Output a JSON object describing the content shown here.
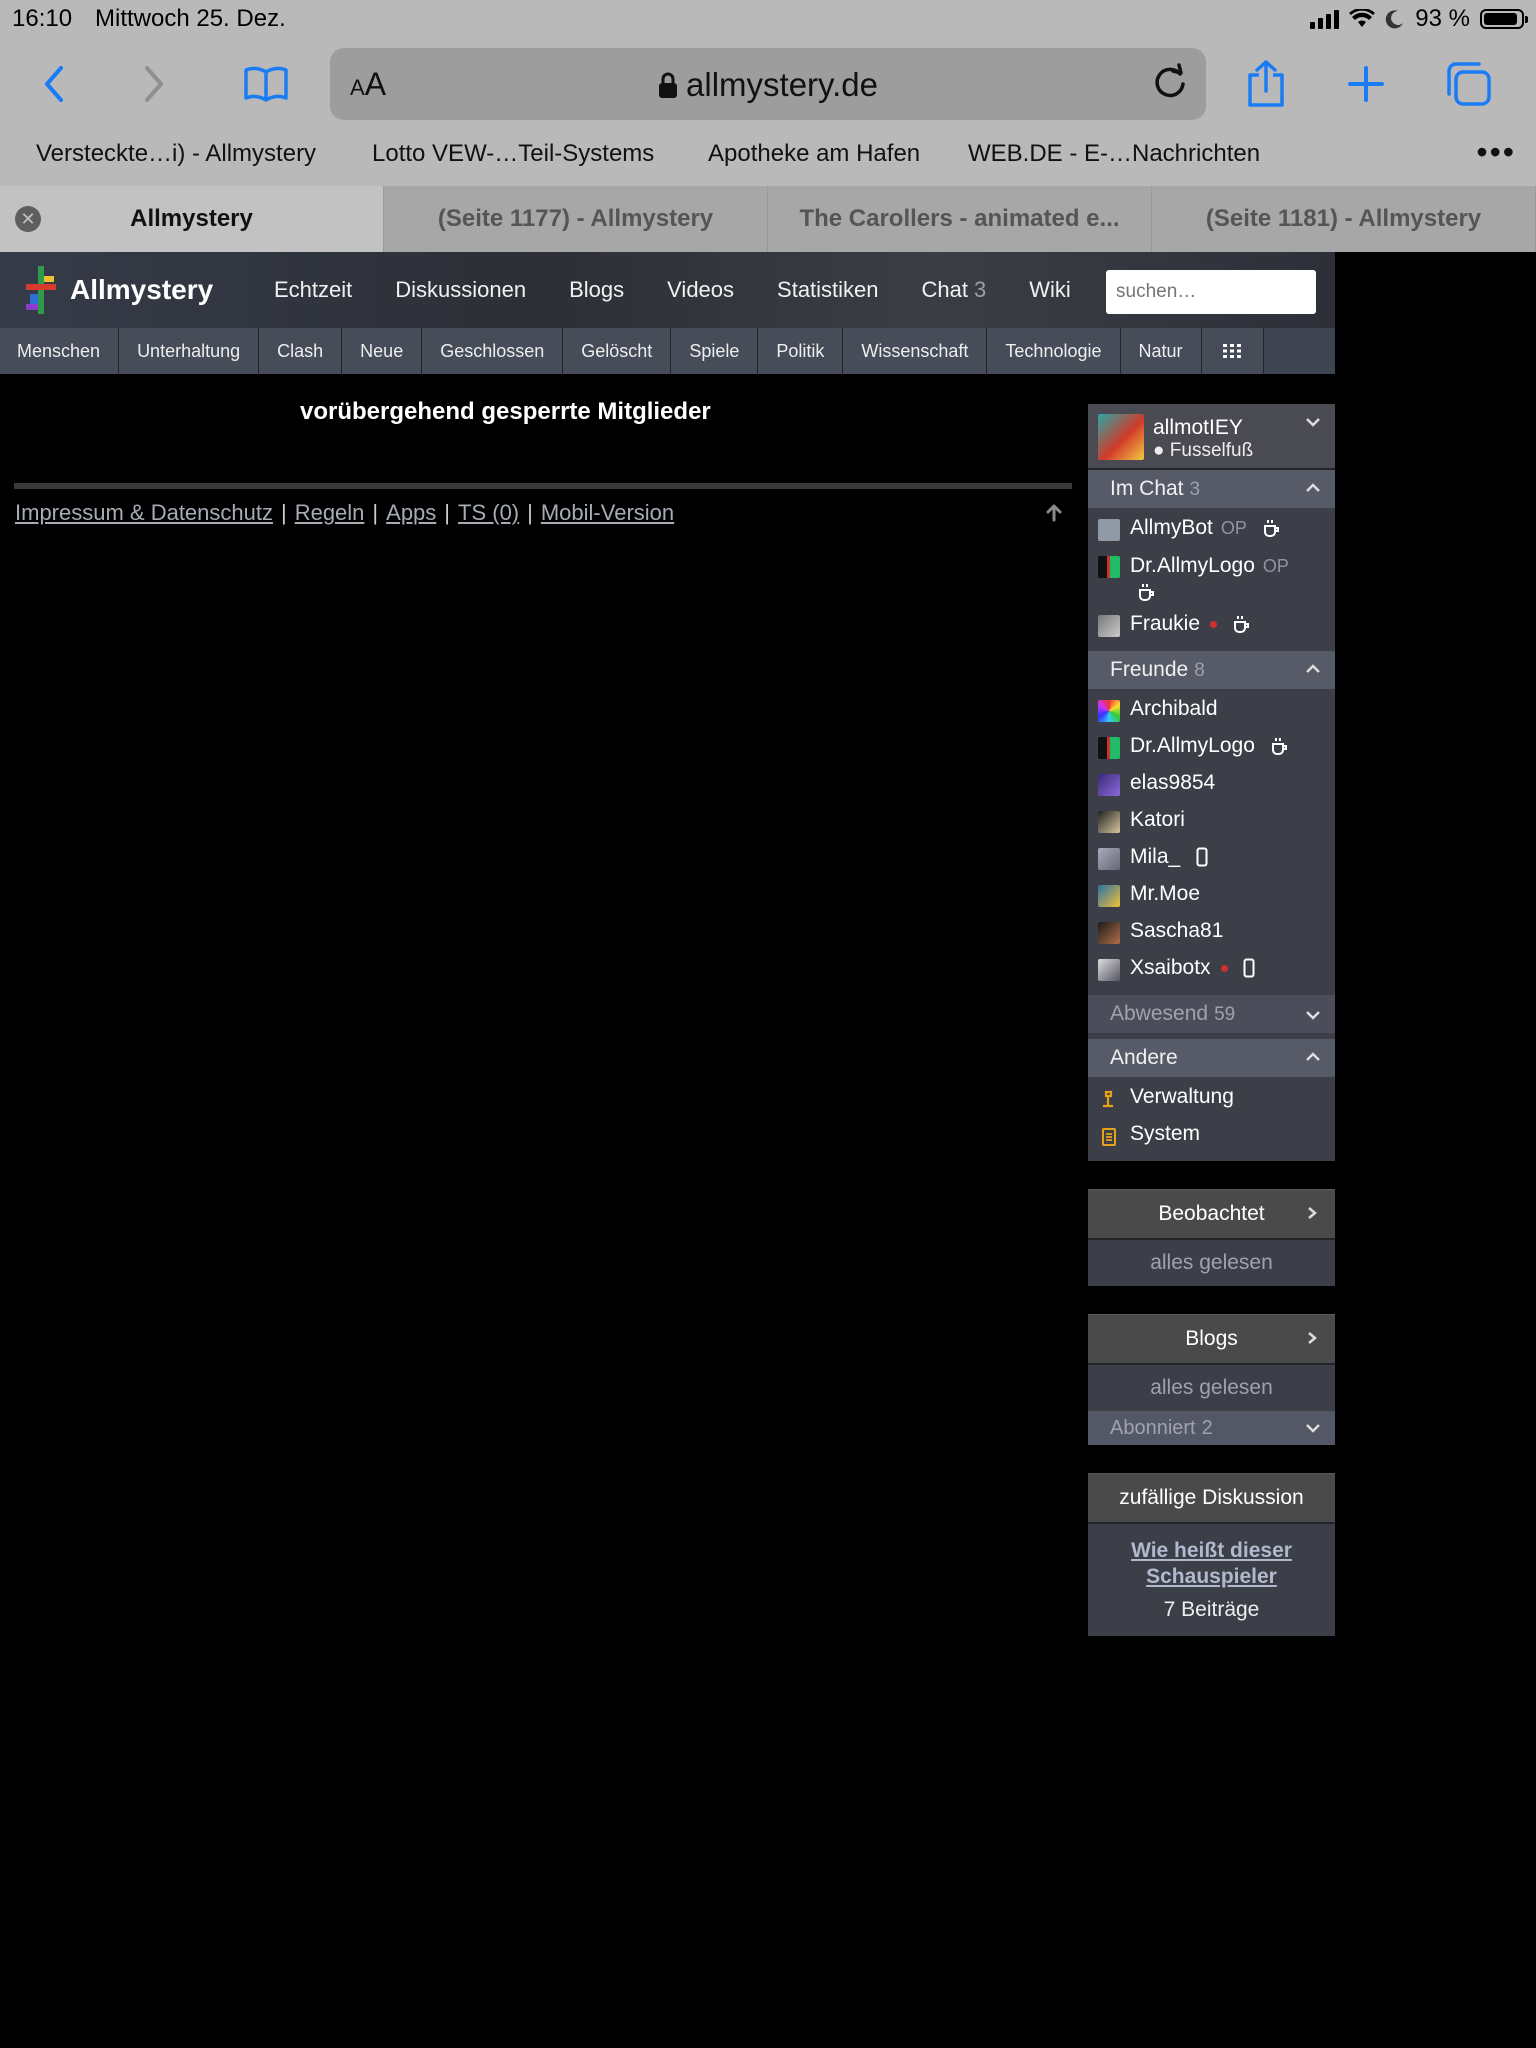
{
  "status_bar": {
    "time": "16:10",
    "date": "Mittwoch 25. Dez.",
    "battery": "93 %",
    "battery_level": 0.93,
    "icons": [
      "signal-icon",
      "wifi-icon",
      "moon-icon",
      "battery-icon"
    ]
  },
  "browser": {
    "text_size_label": "AA",
    "url": "allmystery.de",
    "icons": [
      "back-icon",
      "forward-icon",
      "bookmarks-icon",
      "lock-icon",
      "reload-icon",
      "share-icon",
      "new-tab-icon",
      "tabs-icon"
    ],
    "bookmarks": [
      "Versteckte…i) - Allmystery",
      "Lotto VEW-…Teil-Systems",
      "Apotheke am Hafen",
      "WEB.DE - E-…Nachrichten"
    ],
    "more_label": "•••",
    "tabs": [
      {
        "title": "Allmystery",
        "active": true
      },
      {
        "title": "(Seite 1177) - Allmystery",
        "active": false
      },
      {
        "title": "The Carollers - animated e...",
        "active": false
      },
      {
        "title": "(Seite 1181) - Allmystery",
        "active": false
      }
    ]
  },
  "site": {
    "logo_text": "Allmystery",
    "nav": [
      "Echtzeit",
      "Diskussionen",
      "Blogs",
      "Videos",
      "Statistiken",
      "Chat",
      "Wiki"
    ],
    "chat_count": "3",
    "search_placeholder": "suchen…",
    "categories": [
      "Menschen",
      "Unterhaltung",
      "Clash",
      "Neue",
      "Geschlossen",
      "Gelöscht",
      "Spiele",
      "Politik",
      "Wissenschaft",
      "Technologie",
      "Natur"
    ],
    "page_title": "vorübergehend gesperrte Mitglieder",
    "footer": {
      "links": [
        "Impressum & Datenschutz",
        "Regeln",
        "Apps",
        "TS (0)",
        "Mobil-Version"
      ],
      "separator": "|"
    }
  },
  "sidebar": {
    "user": {
      "name": "allmotIEY",
      "status": "Fusselfuß"
    },
    "im_chat": {
      "label": "Im Chat",
      "count": "3",
      "members": [
        {
          "name": "AllmyBot",
          "op": "OP"
        },
        {
          "name": "Dr.AllmyLogo",
          "op": "OP"
        },
        {
          "name": "Fraukie"
        }
      ]
    },
    "freunde": {
      "label": "Freunde",
      "count": "8",
      "members": [
        "Archibald",
        "Dr.AllmyLogo",
        "elas9854",
        "Katori",
        "Mila_",
        "Mr.Moe",
        "Sascha81",
        "Xsaibotx"
      ]
    },
    "abwesend": {
      "label": "Abwesend",
      "count": "59"
    },
    "andere": {
      "label": "Andere",
      "items": [
        "Verwaltung",
        "System"
      ]
    },
    "beobachtet": {
      "label": "Beobachtet",
      "status": "alles gelesen"
    },
    "blogs": {
      "label": "Blogs",
      "status": "alles gelesen",
      "abonniert_label": "Abonniert",
      "abonniert_count": "2"
    },
    "random": {
      "label": "zufällige Diskussion",
      "topic": "Wie heißt dieser Schauspieler",
      "posts": "7 Beiträge"
    }
  },
  "colors": {
    "ios_blue": "#1a7cf5",
    "chrome_bg": "#b9b9b9",
    "sidebar_bg": "#3c3e48",
    "status_red": "#d0302c",
    "andere_icon": "#e6a21a"
  }
}
